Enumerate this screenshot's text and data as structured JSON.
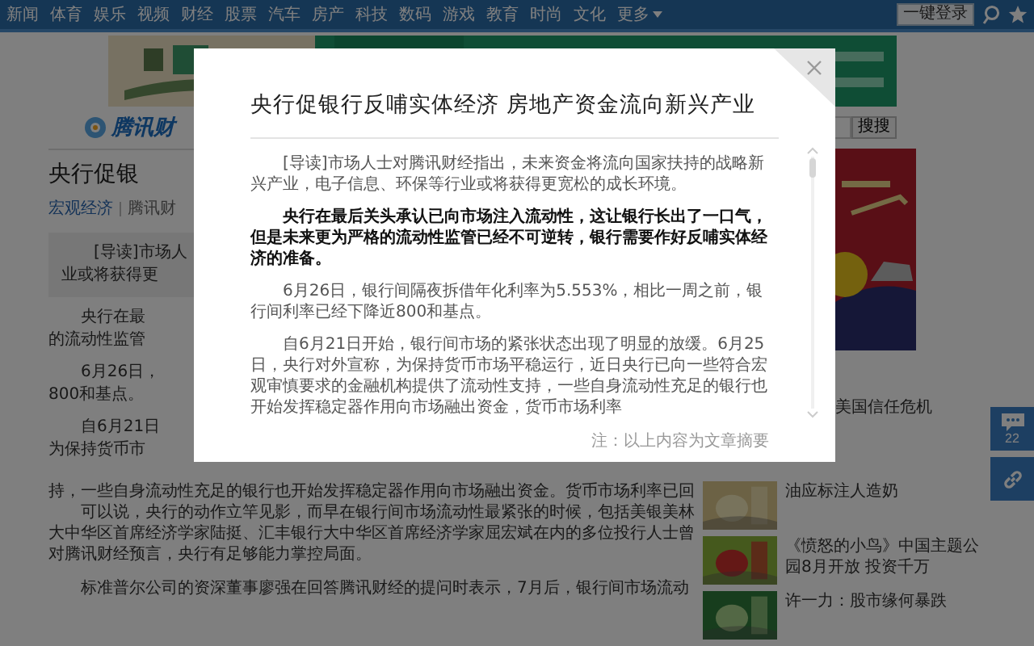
{
  "nav": {
    "items": [
      "新闻",
      "体育",
      "娱乐",
      "视频",
      "财经",
      "股票",
      "汽车",
      "房产",
      "科技",
      "数码",
      "游戏",
      "教育",
      "时尚",
      "文化"
    ],
    "more": "更多",
    "login_button": "一键登录"
  },
  "header": {
    "logo": "腾讯财",
    "search_button": "搜搜"
  },
  "article_peek": {
    "title": "央行促银",
    "category": "宏观经济",
    "source": "腾讯财",
    "lead_lines": [
      "[导读]市场人",
      "业或将获得更"
    ],
    "paragraphs": [
      [
        "央行在最",
        "的流动性监管"
      ],
      [
        "6月26日，",
        "800和基点。"
      ],
      [
        "自6月21日",
        "为保持货币市"
      ]
    ]
  },
  "sidebar_peek": {
    "headline": "美国信任危机"
  },
  "article_continued": [
    {
      "kind": "continuation",
      "text": "持，一些自身流动性充足的银行也开始发挥稳定器作用向市场融出资金。货币市场利率已回"
    },
    {
      "kind": "paragraph",
      "text": "可以说，央行的动作立竿见影，而早在银行间市场流动性最紧张的时候，包括美银美林大中华区首席经济学家陆挺、汇丰银行大中华区首席经济学家屈宏斌在内的多位投行人士曾对腾讯财经预言，央行有足够能力掌控局面。"
    },
    {
      "kind": "paragraph",
      "text": "标准普尔公司的资深董事廖强在回答腾讯财经的提问时表示，7月后，银行间市场流动"
    }
  ],
  "related": [
    {
      "title": "油应标注人造奶"
    },
    {
      "title": "《愤怒的小鸟》中国主题公园8月开放 投资千万"
    },
    {
      "title": "许一力：股市缘何暴跌"
    }
  ],
  "float_buttons": [
    {
      "kind": "comment",
      "count": "22"
    },
    {
      "kind": "link"
    }
  ],
  "modal": {
    "title": "央行促银行反哺实体经济 房地产资金流向新兴产业",
    "paragraphs": [
      {
        "bold": false,
        "text": "[导读]市场人士对腾讯财经指出，未来资金将流向国家扶持的战略新兴产业，电子信息、环保等行业或将获得更宽松的成长环境。"
      },
      {
        "bold": true,
        "text": "央行在最后关头承认已向市场注入流动性，这让银行长出了一口气，但是未来更为严格的流动性监管已经不可逆转，银行需要作好反哺实体经济的准备。"
      },
      {
        "bold": false,
        "text": "6月26日，银行间隔夜拆借年化利率为5.553%，相比一周之前，银行间利率已经下降近800和基点。"
      },
      {
        "bold": false,
        "text": "自6月21日开始，银行间市场的紧张状态出现了明显的放缓。6月25日，央行对外宣称，为保持货币市场平稳运行，近日央行已向一些符合宏观审慎要求的金融机构提供了流动性支持，一些自身流动性充足的银行也开始发挥稳定器作用向市场融出资金，货币市场利率"
      }
    ],
    "note": "注：以上内容为文章摘要"
  }
}
